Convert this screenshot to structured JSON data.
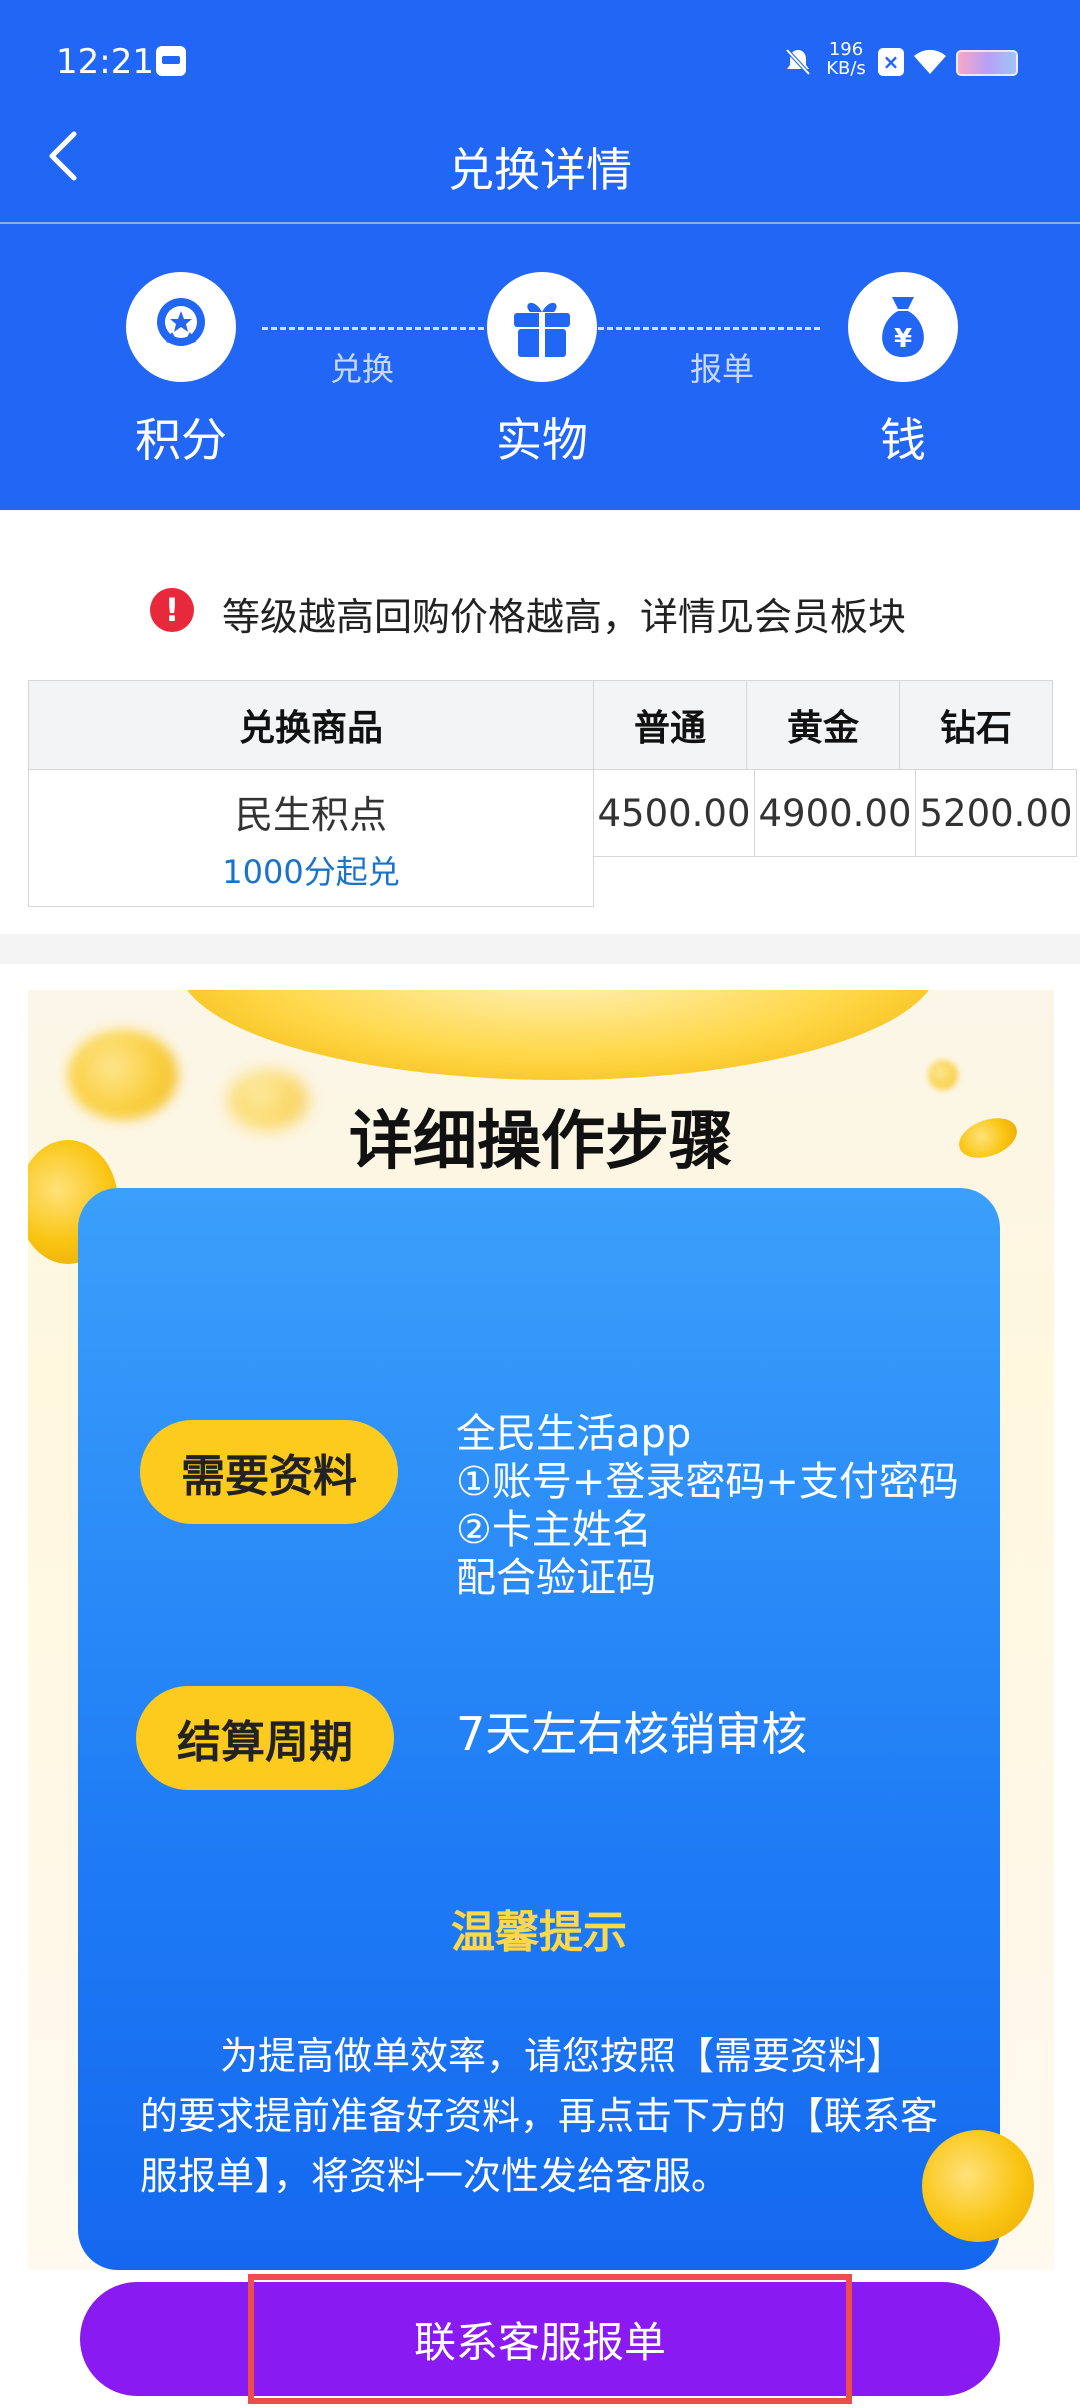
{
  "status_bar": {
    "time": "12:21",
    "net_speed_value": "196",
    "net_speed_unit": "KB/s"
  },
  "nav": {
    "title": "兑换详情",
    "back_icon": "chevron-left-icon"
  },
  "flow": {
    "steps": [
      {
        "label": "积分",
        "icon": "badge-star-icon"
      },
      {
        "label": "实物",
        "icon": "gift-icon"
      },
      {
        "label": "钱",
        "icon": "money-bag-icon"
      }
    ],
    "connectors": [
      "兑换",
      "报单"
    ]
  },
  "notice": {
    "icon": "alert-icon",
    "text": "等级越高回购价格越高，详情见会员板块"
  },
  "table": {
    "headers": [
      "兑换商品",
      "普通",
      "黄金",
      "钻石"
    ],
    "rows": [
      {
        "name": "民生积点",
        "sub": "1000分起兑",
        "values": [
          "4500.00",
          "4900.00",
          "5200.00"
        ]
      }
    ]
  },
  "promo": {
    "title": "详细操作步骤",
    "section1_tag": "需要资料",
    "section1_lines": [
      "全民生活app",
      "①账号+登录密码+支付密码",
      "②卡主姓名",
      "配合验证码"
    ],
    "section2_tag": "结算周期",
    "section2_text": "7天左右核销审核",
    "tip_title": "温馨提示",
    "tip_text": "为提高做单效率，请您按照【需要资料】的要求提前准备好资料，再点击下方的【联系客服报单】，将资料一次性发给客服。"
  },
  "bottom": {
    "contact_button": "联系客服报单"
  },
  "colors": {
    "brand_blue": "#2266f5",
    "button_purple": "#8a1af2",
    "tag_yellow": "#fccb1e",
    "alert_red": "#e8283b",
    "link_blue": "#1a73c9"
  }
}
